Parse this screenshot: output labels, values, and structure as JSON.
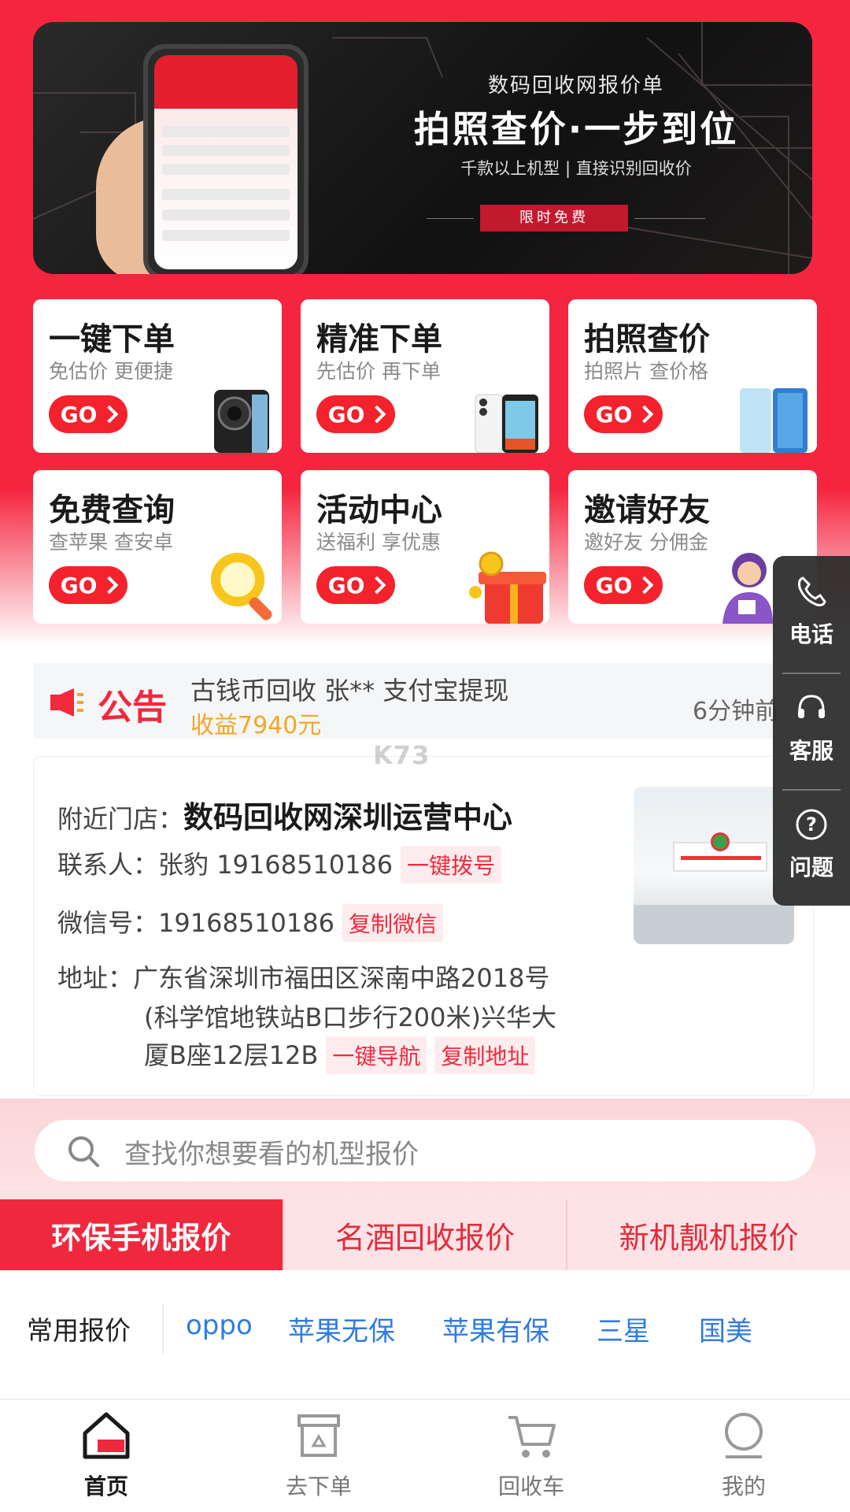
{
  "banner": {
    "subtitle": "数码回收网报价单",
    "title": "拍照查价·一步到位",
    "description": "千款以上机型 | 直接识别回收价",
    "badge": "限时免费"
  },
  "cards": [
    {
      "title": "一键下单",
      "subtitle": "免估价 更便捷",
      "go": "GO",
      "image": "phone-dark-icon"
    },
    {
      "title": "精准下单",
      "subtitle": "先估价 再下单",
      "go": "GO",
      "image": "phone-iphone-icon"
    },
    {
      "title": "拍照查价",
      "subtitle": "拍照片 查价格",
      "go": "GO",
      "image": "phone-blue-icon"
    },
    {
      "title": "免费查询",
      "subtitle": "查苹果 查安卓",
      "go": "GO",
      "image": "magnifier-icon"
    },
    {
      "title": "活动中心",
      "subtitle": "送福利 享优惠",
      "go": "GO",
      "image": "gift-box-icon"
    },
    {
      "title": "邀请好友",
      "subtitle": "邀好友 分佣金",
      "go": "GO",
      "image": "person-icon"
    }
  ],
  "side_panel": [
    {
      "label": "电话",
      "icon": "phone-icon"
    },
    {
      "label": "客服",
      "icon": "headset-icon"
    },
    {
      "label": "问题",
      "icon": "question-icon"
    }
  ],
  "notice": {
    "label": "公告",
    "text": "古钱币回收 张** 支付宝提现",
    "amount": "收益7940元",
    "time": "6分钟前"
  },
  "watermark": "K73",
  "store": {
    "nearby_label": "附近门店：",
    "name": "数码回收网深圳运营中心",
    "contact_label": "联系人：",
    "contact": "张豹 19168510186",
    "call_button": "一键拨号",
    "wechat_label": "微信号：",
    "wechat": "19168510186",
    "copy_wechat_button": "复制微信",
    "address_label": "地址：",
    "address_line1": "广东省深圳市福田区深南中路2018号",
    "address_line2": "(科学馆地铁站B口步行200米)兴华大",
    "address_line3": "厦B座12层12B",
    "navigate_button": "一键导航",
    "copy_address_button": "复制地址"
  },
  "search": {
    "placeholder": "查找你想要看的机型报价"
  },
  "tabs": [
    {
      "label": "环保手机报价",
      "active": true
    },
    {
      "label": "名酒回收报价",
      "active": false
    },
    {
      "label": "新机靓机报价",
      "active": false
    }
  ],
  "quotes": {
    "label": "常用报价",
    "links": [
      "oppo",
      "苹果无保",
      "苹果有保",
      "三星",
      "国美"
    ]
  },
  "bottom_nav": [
    {
      "label": "首页",
      "icon": "home-icon",
      "active": true
    },
    {
      "label": "去下单",
      "icon": "order-box-icon",
      "active": false
    },
    {
      "label": "回收车",
      "icon": "cart-icon",
      "active": false
    },
    {
      "label": "我的",
      "icon": "profile-icon",
      "active": false
    }
  ],
  "colors": {
    "brand_red": "#f5253f",
    "go_red": "#f3222c",
    "link_blue": "#2f7be0",
    "amount_orange": "#f5a623"
  }
}
